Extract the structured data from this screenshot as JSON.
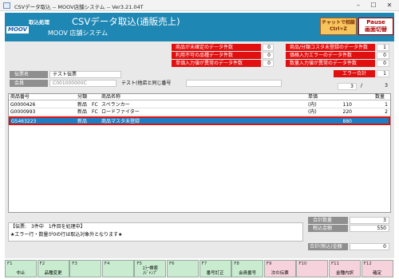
{
  "window": {
    "title": "CSVデータ取込 -- MOOV店舗システム -- Ver3.21.04T"
  },
  "header": {
    "mode": "取込処理",
    "title": "CSVデータ取込(通販売上)",
    "system": "MOOV 店舗システム",
    "logo": "MOOV",
    "chat_label": "チャットで相談",
    "chat_key": "Ctrl+Z",
    "pause_label": "Pause",
    "pause_sub": "画面切替"
  },
  "errors_left": [
    {
      "label": "商品が未確定のデータ件数",
      "count": "0"
    },
    {
      "label": "利用不可の品種データ件数",
      "count": "0"
    },
    {
      "label": "単価入力値が異常のデータ件数",
      "count": "0"
    }
  ],
  "errors_right": [
    {
      "label": "商品/分類コスタ未登録のデータ件数",
      "count": "1"
    },
    {
      "label": "価格入力エラーのデータ件数",
      "count": "0"
    },
    {
      "label": "数量入力値が異常のデータ件数",
      "count": "0"
    }
  ],
  "error_total": {
    "label": "エラー合計",
    "value": "1"
  },
  "slip": {
    "no_label": "伝票名",
    "no_value": "テスト伝票",
    "member_label": "会員",
    "member_value": "C001000000C",
    "member_name": "テスト(他店と同じ番号"
  },
  "pager": {
    "current": "3",
    "sep": "/",
    "total": "3"
  },
  "grid": {
    "headers": {
      "code": "商品番号",
      "cat": "分類",
      "name": "商品名称",
      "unit": "単価",
      "qty": "数量"
    },
    "rows": [
      {
        "code": "G0000426",
        "cat": "新品",
        "sub": "FC",
        "name": "スペランカー",
        "unit": "(内)",
        "price": "110",
        "qty": "1"
      },
      {
        "code": "G0000993",
        "cat": "新品",
        "sub": "FC",
        "name": "ロードファイター",
        "unit": "(内)",
        "price": "220",
        "qty": "2"
      },
      {
        "code": "G5463223",
        "cat": "新品",
        "sub": "",
        "name": "商品マスタ未登録",
        "unit": "",
        "price": "880",
        "qty": "",
        "selected": true
      }
    ]
  },
  "status": {
    "line1": "【伝票:　3件中　1件目を処理中】",
    "line2": "★エラー行・数量が0の行は取込対象外となります★"
  },
  "summary": {
    "qty_label": "合計数量",
    "qty_value": "3",
    "tax_label": "税込金額",
    "tax_value": "550",
    "total_label": "合計(税込)金額",
    "total_value": "0"
  },
  "fkeys": [
    {
      "key": "F1",
      "label": "中止",
      "color": "#c9ecd1"
    },
    {
      "key": "F2",
      "label": "品種変更",
      "color": "#c9ecd1"
    },
    {
      "key": "F3",
      "label": "",
      "color": "#c9ecd1"
    },
    {
      "key": "F4",
      "label": "",
      "color": "#c9ecd1"
    },
    {
      "key": "F5",
      "label": "ｴﾗｰ検索\n/ｼﾞｬﾝﾌﾟ",
      "color": "#c9ecd1"
    },
    {
      "key": "F6",
      "label": "",
      "color": "#c9ecd1"
    },
    {
      "key": "F7",
      "label": "番号訂正",
      "color": "#c9ecd1"
    },
    {
      "key": "F8",
      "label": "会員番号",
      "color": "#c9ecd1"
    },
    {
      "key": "F9",
      "label": "次の伝票",
      "color": "#f6d2dd"
    },
    {
      "key": "F10",
      "label": "",
      "color": "#f6d2dd"
    },
    {
      "key": "F11",
      "label": "金種内訳",
      "color": "#f6d2dd"
    },
    {
      "key": "F12",
      "label": "確定",
      "color": "#f6d2dd"
    }
  ]
}
